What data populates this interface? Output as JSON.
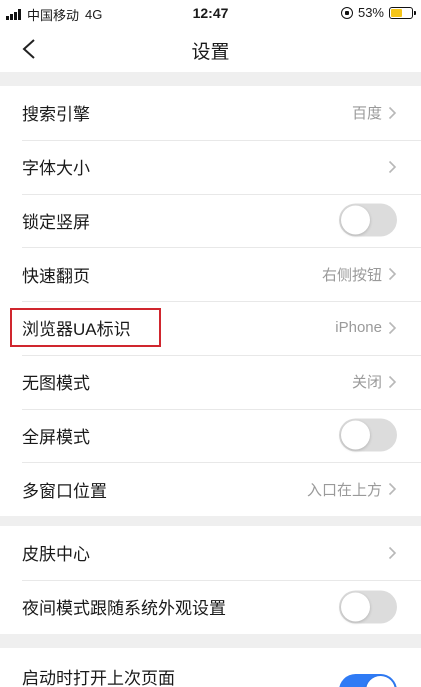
{
  "status_bar": {
    "carrier": "中国移动",
    "network": "4G",
    "time": "12:47",
    "battery_percent": "53%",
    "battery_level": 0.53,
    "battery_color": "#f5c518"
  },
  "nav": {
    "back_icon": "chevron-left-icon",
    "title": "设置"
  },
  "groups": [
    {
      "items": [
        {
          "label": "搜索引擎",
          "value": "百度",
          "type": "link"
        },
        {
          "label": "字体大小",
          "value": "",
          "type": "link"
        },
        {
          "label": "锁定竖屏",
          "type": "toggle",
          "on": false
        },
        {
          "label": "快速翻页",
          "value": "右侧按钮",
          "type": "link"
        },
        {
          "label": "浏览器UA标识",
          "value": "iPhone",
          "type": "link",
          "highlighted": true
        },
        {
          "label": "无图模式",
          "value": "关闭",
          "type": "link"
        },
        {
          "label": "全屏模式",
          "type": "toggle",
          "on": false
        },
        {
          "label": "多窗口位置",
          "value": "入口在上方",
          "type": "link"
        }
      ]
    },
    {
      "items": [
        {
          "label": "皮肤中心",
          "value": "",
          "type": "link"
        },
        {
          "label": "夜间模式跟随系统外观设置",
          "type": "toggle",
          "on": false
        }
      ]
    },
    {
      "items": [
        {
          "label": "启动时打开上次页面",
          "type": "toggle",
          "on": true
        }
      ]
    }
  ],
  "colors": {
    "toggle_on": "#2f7bf5",
    "toggle_off": "#dcdcdc",
    "highlight": "#d0262e"
  }
}
